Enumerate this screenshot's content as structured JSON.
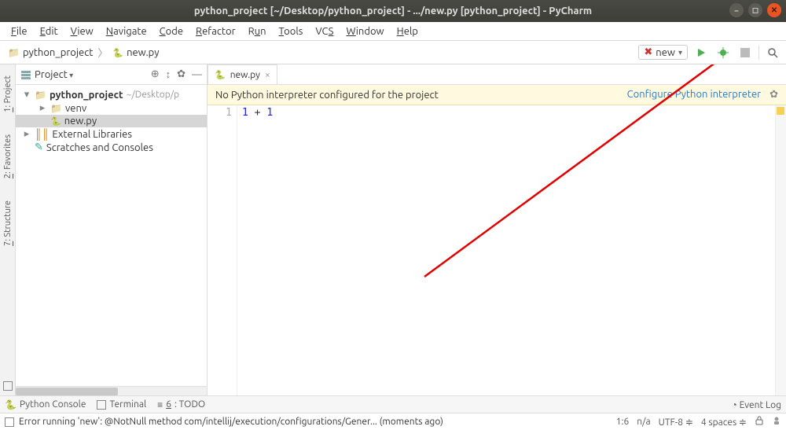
{
  "titlebar": {
    "title": "python_project [~/Desktop/python_project] - .../new.py [python_project] - PyCharm"
  },
  "menu": {
    "file": "File",
    "edit": "Edit",
    "view": "View",
    "navigate": "Navigate",
    "code": "Code",
    "refactor": "Refactor",
    "run": "Run",
    "tools": "Tools",
    "vcs": "VCS",
    "window": "Window",
    "help": "Help"
  },
  "breadcrumbs": {
    "root": "python_project",
    "file": "new.py"
  },
  "run_config": {
    "name": "new"
  },
  "left_tabs": {
    "project": "1: Project",
    "favorites": "2: Favorites",
    "structure": "7: Structure"
  },
  "project_tool": {
    "title": "Project",
    "tree": {
      "root": "python_project",
      "root_path": "~/Desktop/p",
      "venv": "venv",
      "file": "new.py",
      "external": "External Libraries",
      "scratches": "Scratches and Consoles"
    }
  },
  "editor": {
    "tab": "new.py",
    "banner": {
      "msg": "No Python interpreter configured for the project",
      "link": "Configure Python interpreter"
    },
    "gutter_line": "1",
    "code_tokens": {
      "a": "1",
      "op": "+",
      "b": "1"
    }
  },
  "bottom_tabs": {
    "console": "Python Console",
    "terminal": "Terminal",
    "todo": "6: TODO",
    "event_log": "Event Log"
  },
  "status": {
    "msg": "Error running 'new': @NotNull method com/intellij/execution/configurations/Gener... (moments ago)",
    "pos": "1:6",
    "na": "n/a",
    "encoding": "UTF-8",
    "indent": "4 spaces"
  }
}
